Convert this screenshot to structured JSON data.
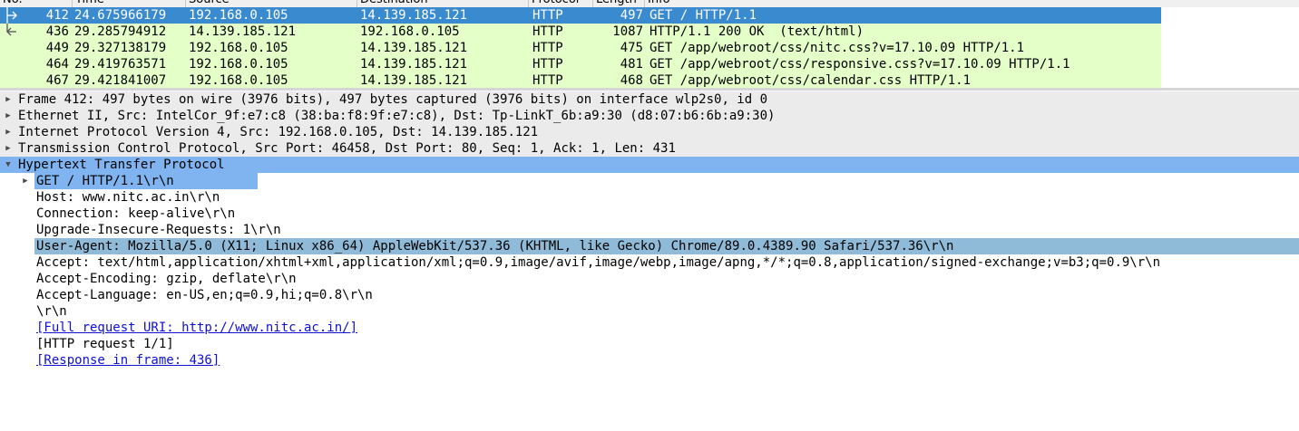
{
  "packet_list": {
    "columns": [
      "No.",
      "Time",
      "Source",
      "Destination",
      "Protocol",
      "Length",
      "Info"
    ],
    "rows": [
      {
        "no": "412",
        "time": "24.675966179",
        "source": "192.168.0.105",
        "destination": "14.139.185.121",
        "protocol": "HTTP",
        "length": "497",
        "info": "GET / HTTP/1.1",
        "selected": true
      },
      {
        "no": "436",
        "time": "29.285794912",
        "source": "14.139.185.121",
        "destination": "192.168.0.105",
        "protocol": "HTTP",
        "length": "1087",
        "info": "HTTP/1.1 200 OK  (text/html)",
        "selected": false
      },
      {
        "no": "449",
        "time": "29.327138179",
        "source": "192.168.0.105",
        "destination": "14.139.185.121",
        "protocol": "HTTP",
        "length": "475",
        "info": "GET /app/webroot/css/nitc.css?v=17.10.09 HTTP/1.1",
        "selected": false
      },
      {
        "no": "464",
        "time": "29.419763571",
        "source": "192.168.0.105",
        "destination": "14.139.185.121",
        "protocol": "HTTP",
        "length": "481",
        "info": "GET /app/webroot/css/responsive.css?v=17.10.09 HTTP/1.1",
        "selected": false
      },
      {
        "no": "467",
        "time": "29.421841007",
        "source": "192.168.0.105",
        "destination": "14.139.185.121",
        "protocol": "HTTP",
        "length": "468",
        "info": "GET /app/webroot/css/calendar.css HTTP/1.1",
        "selected": false
      }
    ]
  },
  "details": {
    "frame": "Frame 412: 497 bytes on wire (3976 bits), 497 bytes captured (3976 bits) on interface wlp2s0, id 0",
    "ethernet": "Ethernet II, Src: IntelCor_9f:e7:c8 (38:ba:f8:9f:e7:c8), Dst: Tp-LinkT_6b:a9:30 (d8:07:b6:6b:a9:30)",
    "ip": "Internet Protocol Version 4, Src: 192.168.0.105, Dst: 14.139.185.121",
    "tcp": "Transmission Control Protocol, Src Port: 46458, Dst Port: 80, Seq: 1, Ack: 1, Len: 431",
    "http": "Hypertext Transfer Protocol",
    "http_fields": {
      "request_line": "GET / HTTP/1.1\\r\\n",
      "host": "Host: www.nitc.ac.in\\r\\n",
      "connection": "Connection: keep-alive\\r\\n",
      "upgrade": "Upgrade-Insecure-Requests: 1\\r\\n",
      "user_agent": "User-Agent: Mozilla/5.0 (X11; Linux x86_64) AppleWebKit/537.36 (KHTML, like Gecko) Chrome/89.0.4389.90 Safari/537.36\\r\\n",
      "accept": "Accept: text/html,application/xhtml+xml,application/xml;q=0.9,image/avif,image/webp,image/apng,*/*;q=0.8,application/signed-exchange;v=b3;q=0.9\\r\\n",
      "accept_encoding": "Accept-Encoding: gzip, deflate\\r\\n",
      "accept_language": "Accept-Language: en-US,en;q=0.9,hi;q=0.8\\r\\n",
      "crlf": "\\r\\n",
      "full_uri": "[Full request URI: http://www.nitc.ac.in/]",
      "request_num": "[HTTP request 1/1]",
      "response_in": "[Response in frame: 436]"
    }
  },
  "colors": {
    "selected_row": "#3a8ad0",
    "http_row": "#e4ffc7",
    "tree_highlight": "#80b4f0",
    "field_highlight": "#90bbd8",
    "link": "#1010d0"
  }
}
